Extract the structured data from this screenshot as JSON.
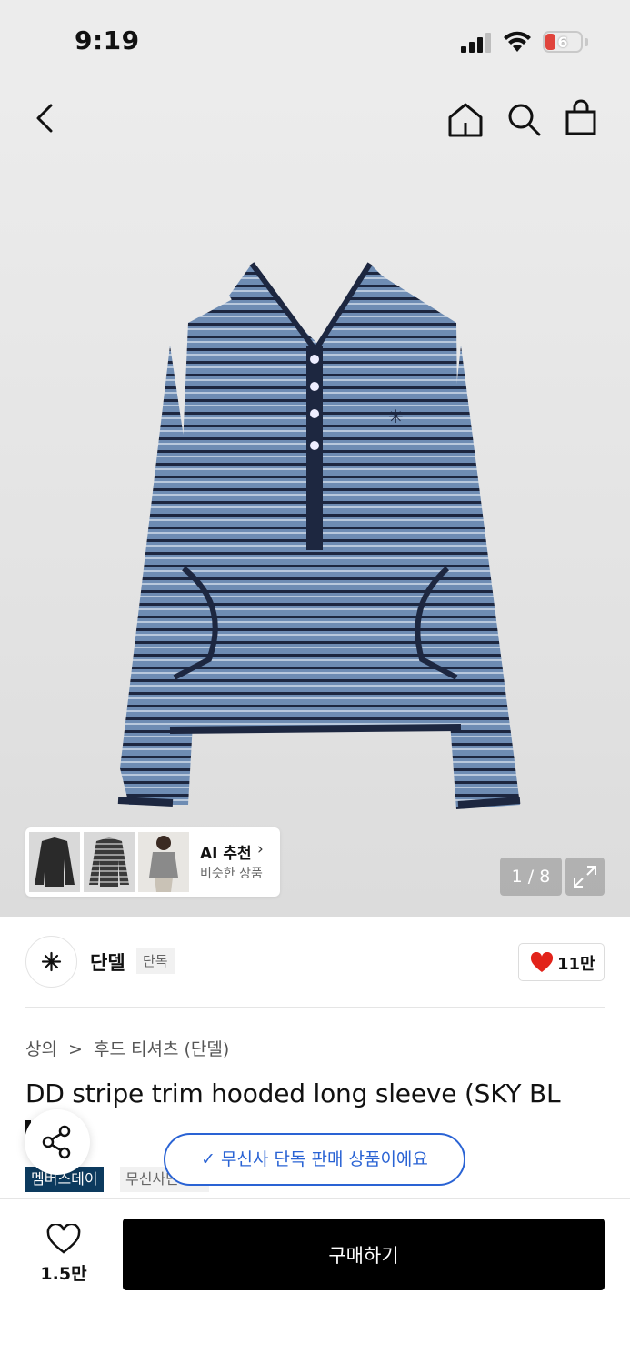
{
  "status_bar": {
    "time": "9:19",
    "battery": "6"
  },
  "ai_recommend": {
    "title": "AI 추천",
    "subtitle": "비슷한 상품"
  },
  "gallery": {
    "counter": "1 / 8"
  },
  "brand": {
    "name": "단델",
    "tag": "단독",
    "likes": "11만"
  },
  "breadcrumb": {
    "category": "상의",
    "separator": ">",
    "subcategory": "후드 티셔츠 (단델)"
  },
  "product": {
    "title": "DD stripe trim hooded long sleeve (SKY BL"
  },
  "badges": {
    "primary": "멤버스데이",
    "secondary": "무신사단독"
  },
  "toast": {
    "text": "무신사 단독 판매 상품이에요"
  },
  "bottom": {
    "wish_count": "1.5만",
    "buy_label": "구매하기"
  },
  "colors": {
    "accent": "#2a63d4",
    "badge": "#0c3a5e",
    "heart": "#e2231a",
    "buy": "#000000"
  }
}
